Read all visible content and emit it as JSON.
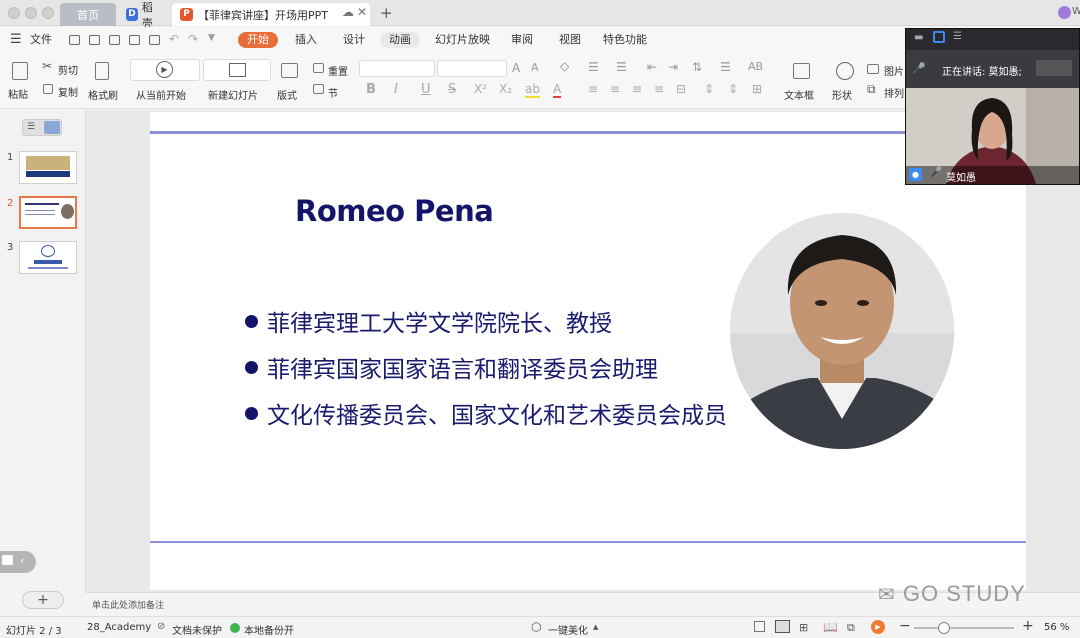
{
  "tabs": {
    "home": "首页",
    "docer": "稻壳",
    "document": "【菲律宾讲座】开场用PPT",
    "add": "+",
    "account": "W"
  },
  "menu": {
    "file": "文件",
    "items": [
      "开始",
      "插入",
      "设计",
      "动画",
      "幻灯片放映",
      "审阅",
      "视图",
      "特色功能"
    ]
  },
  "ribbon": {
    "paste": "粘贴",
    "cut": "剪切",
    "copy": "复制",
    "format_painter": "格式刷",
    "play_from_current": "从当前开始",
    "new_slide": "新建幻灯片",
    "layout": "版式",
    "reset": "重置",
    "section": "节",
    "textbox": "文本框",
    "shape": "形状",
    "picture": "图片",
    "arrange": "排列"
  },
  "slides_panel": {
    "numbers": [
      "1",
      "2",
      "3"
    ],
    "add": "+"
  },
  "slide": {
    "title": "Romeo Pena",
    "bullets": [
      "菲律宾理工大学文学院院长、教授",
      "菲律宾国家国家语言和翻译委员会助理",
      "文化传播委员会、国家文化和艺术委员会成员"
    ]
  },
  "notes_placeholder": "单击此处添加备注",
  "status": {
    "slide_counter": "幻灯片 2 / 3",
    "theme": "28_Academy",
    "protection": "文档未保护",
    "backup": "本地备份开",
    "beautify": "一键美化",
    "zoom": "56 %"
  },
  "video": {
    "speaking": "正在讲话: 莫如愚;",
    "participant": "莫如愚"
  },
  "watermark": "GO STUDY"
}
